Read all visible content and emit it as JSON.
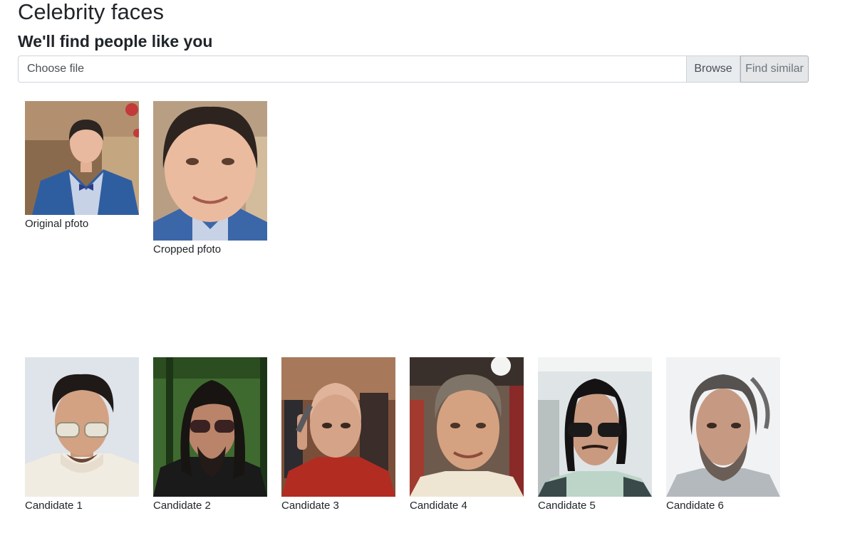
{
  "header": {
    "title": "Celebrity faces",
    "subtitle": "We'll find people like you"
  },
  "upload": {
    "placeholder": "Choose file",
    "browse_label": "Browse",
    "find_label": "Find similar"
  },
  "source_photos": [
    {
      "caption": "Original pfoto"
    },
    {
      "caption": "Cropped pfoto"
    }
  ],
  "candidates": [
    {
      "caption": "Candidate 1"
    },
    {
      "caption": "Candidate 2"
    },
    {
      "caption": "Candidate 3"
    },
    {
      "caption": "Candidate 4"
    },
    {
      "caption": "Candidate 5"
    },
    {
      "caption": "Candidate 6"
    }
  ]
}
